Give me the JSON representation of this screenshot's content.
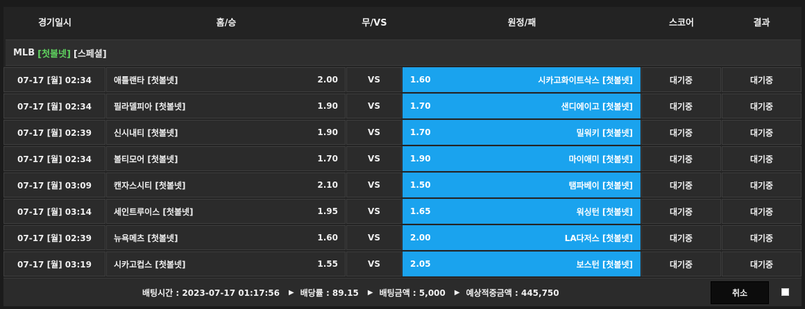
{
  "header": {
    "date": "경기일시",
    "home": "홈/승",
    "draw": "무/VS",
    "away": "원정/패",
    "score": "스코어",
    "result": "결과"
  },
  "section": {
    "league": "MLB",
    "tag1": "[첫볼넷]",
    "tag2": "[스페셜]"
  },
  "rows": [
    {
      "date": "07-17 [월] 02:34",
      "home": "애틀랜타 [첫볼넷]",
      "home_odds": "2.00",
      "vs": "VS",
      "away_odds": "1.60",
      "away": "시카고화이트삭스 [첫볼넷]",
      "score": "대기중",
      "result": "대기중"
    },
    {
      "date": "07-17 [월] 02:34",
      "home": "필라델피아 [첫볼넷]",
      "home_odds": "1.90",
      "vs": "VS",
      "away_odds": "1.70",
      "away": "샌디에이고 [첫볼넷]",
      "score": "대기중",
      "result": "대기중"
    },
    {
      "date": "07-17 [월] 02:39",
      "home": "신시내티 [첫볼넷]",
      "home_odds": "1.90",
      "vs": "VS",
      "away_odds": "1.70",
      "away": "밀워키 [첫볼넷]",
      "score": "대기중",
      "result": "대기중"
    },
    {
      "date": "07-17 [월] 02:34",
      "home": "볼티모어 [첫볼넷]",
      "home_odds": "1.70",
      "vs": "VS",
      "away_odds": "1.90",
      "away": "마이애미 [첫볼넷]",
      "score": "대기중",
      "result": "대기중"
    },
    {
      "date": "07-17 [월] 03:09",
      "home": "캔자스시티 [첫볼넷]",
      "home_odds": "2.10",
      "vs": "VS",
      "away_odds": "1.50",
      "away": "탬파베이 [첫볼넷]",
      "score": "대기중",
      "result": "대기중"
    },
    {
      "date": "07-17 [월] 03:14",
      "home": "세인트루이스 [첫볼넷]",
      "home_odds": "1.95",
      "vs": "VS",
      "away_odds": "1.65",
      "away": "워싱턴 [첫볼넷]",
      "score": "대기중",
      "result": "대기중"
    },
    {
      "date": "07-17 [월] 02:39",
      "home": "뉴욕메츠 [첫볼넷]",
      "home_odds": "1.60",
      "vs": "VS",
      "away_odds": "2.00",
      "away": "LA다저스 [첫볼넷]",
      "score": "대기중",
      "result": "대기중"
    },
    {
      "date": "07-17 [월] 03:19",
      "home": "시카고컵스 [첫볼넷]",
      "home_odds": "1.55",
      "vs": "VS",
      "away_odds": "2.05",
      "away": "보스턴 [첫볼넷]",
      "score": "대기중",
      "result": "대기중"
    }
  ],
  "footer": {
    "bet_time": "배팅시간 : 2023-07-17 01:17:56",
    "odds": "배당률 : 89.15",
    "amount": "배팅금액 : 5,000",
    "expected": "예상적중금액 : 445,750",
    "cancel_label": "취소"
  },
  "colors": {
    "away_highlight": "#1aa3ee",
    "league_tag": "#5fd35f",
    "background": "#1b1b1b"
  }
}
